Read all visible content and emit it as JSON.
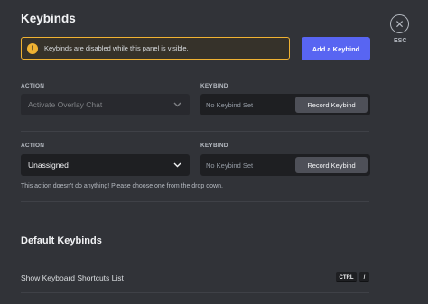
{
  "header": {
    "title": "Keybinds",
    "close_label": "ESC"
  },
  "notice": {
    "text": "Keybinds are disabled while this panel is visible.",
    "icon": "warning-icon"
  },
  "add_button": {
    "label": "Add a Keybind"
  },
  "keybinds": [
    {
      "action_label": "ACTION",
      "keybind_label": "KEYBIND",
      "action_value": "Activate Overlay Chat",
      "keybind_value": "No Keybind Set",
      "record_label": "Record Keybind",
      "disabled": true
    },
    {
      "action_label": "ACTION",
      "keybind_label": "KEYBIND",
      "action_value": "Unassigned",
      "keybind_value": "No Keybind Set",
      "record_label": "Record Keybind",
      "disabled": false,
      "helper": "This action doesn't do anything! Please choose one from the drop down."
    }
  ],
  "defaults": {
    "title": "Default Keybinds",
    "items": [
      {
        "label": "Show Keyboard Shortcuts List",
        "keys": [
          "CTRL",
          "/"
        ]
      }
    ]
  },
  "colors": {
    "accent": "#5865f2",
    "warning": "#f0b232",
    "background": "#313338"
  }
}
